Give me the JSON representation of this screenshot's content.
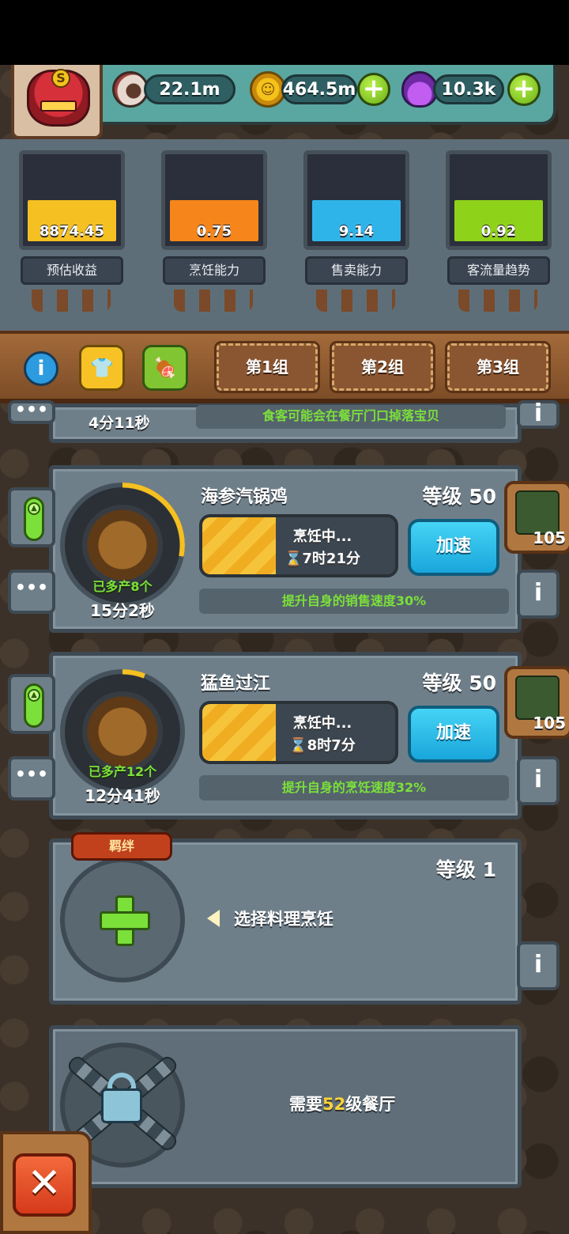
{
  "resources": {
    "eyes": "22.1m",
    "coins": "464.5m",
    "potions": "10.3k",
    "avatar_badge": "S"
  },
  "stats": [
    {
      "value": "8874.45",
      "label": "预估收益",
      "color": "#f5c021",
      "level": 0.42
    },
    {
      "value": "0.75",
      "label": "烹饪能力",
      "color": "#f6861b",
      "level": 0.42
    },
    {
      "value": "9.14",
      "label": "售卖能力",
      "color": "#2fb4ea",
      "level": 0.42
    },
    {
      "value": "0.92",
      "label": "客流量趋势",
      "color": "#8fd21a",
      "level": 0.42
    }
  ],
  "toolbar": {
    "info_icon": "i",
    "groups": [
      "第1组",
      "第2组",
      "第3组"
    ]
  },
  "partial": {
    "timer": "4分11秒",
    "note": "食客可能会在餐厅门口掉落宝贝"
  },
  "dishes": [
    {
      "name": "海参汽锅鸡",
      "level": "等级 50",
      "status": "烹饪中...",
      "remaining": "⌛7时21分",
      "progress": 0.38,
      "speed_label": "加速",
      "produced": "已多产8个",
      "timer": "15分2秒",
      "bonus": "提升自身的销售速度30%",
      "reward_count": "105",
      "ring_progress": 0.28
    },
    {
      "name": "猛鱼过江",
      "level": "等级 50",
      "status": "烹饪中...",
      "remaining": "⌛8时7分",
      "progress": 0.38,
      "speed_label": "加速",
      "produced": "已多产12个",
      "timer": "12分41秒",
      "bonus": "提升自身的烹饪速度32%",
      "reward_count": "105",
      "ring_progress": 0.06
    }
  ],
  "empty_slot": {
    "tag": "羁绊",
    "level": "等级 1",
    "prompt": "选择料理烹饪"
  },
  "locked_slot": {
    "prefix": "需要",
    "level": "52",
    "suffix": "级餐厅"
  },
  "close_label": "✕",
  "more_dots": "•••",
  "info_glyph": "i"
}
